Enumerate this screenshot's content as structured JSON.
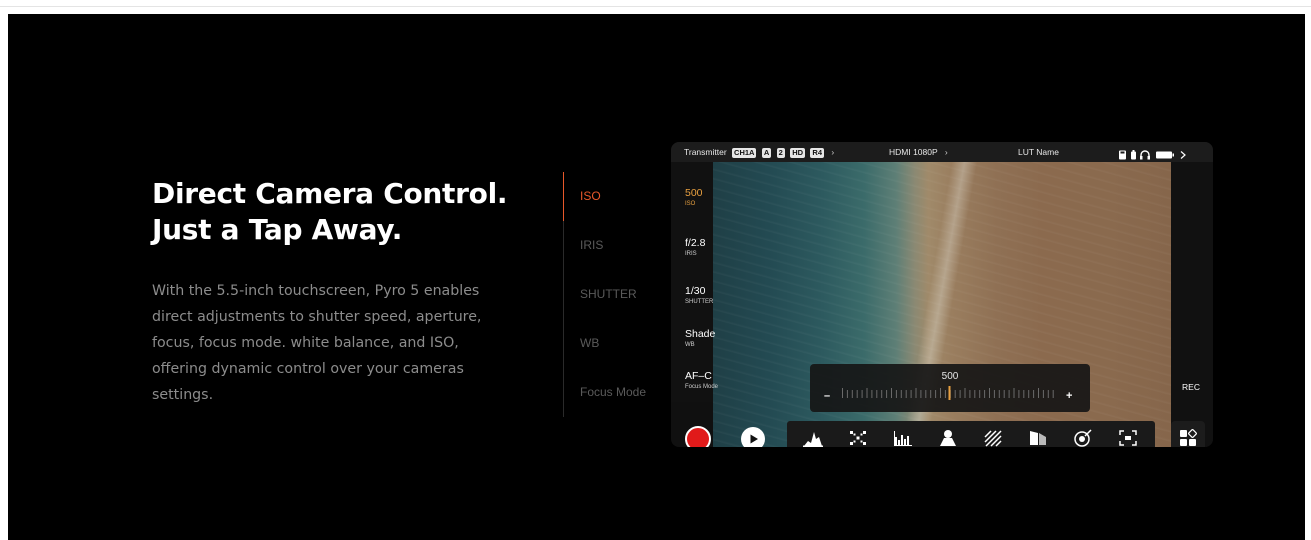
{
  "hero": {
    "title_line1": "Direct Camera Control.",
    "title_line2": "Just a Tap Away.",
    "description": "With the 5.5-inch touchscreen, Pyro 5 enables direct adjustments to shutter speed, aperture, focus, focus mode. white balance, and ISO, offering dynamic control over your cameras settings."
  },
  "tabs": [
    {
      "label": "ISO",
      "active": true
    },
    {
      "label": "IRIS",
      "active": false
    },
    {
      "label": "SHUTTER",
      "active": false
    },
    {
      "label": "WB",
      "active": false
    },
    {
      "label": "Focus Mode",
      "active": false
    }
  ],
  "device": {
    "status": {
      "transmitter_label": "Transmitter",
      "chips": [
        "CH1A",
        "A",
        "2",
        "HD",
        "R4"
      ],
      "hdmi": "HDMI 1080P",
      "lut": "LUT Name"
    },
    "params": [
      {
        "value": "500",
        "label": "ISO"
      },
      {
        "value": "f/2.8",
        "label": "IRIS"
      },
      {
        "value": "1/30",
        "label": "SHUTTER"
      },
      {
        "value": "Shade",
        "label": "WB"
      },
      {
        "value": "AF–C",
        "label": "Focus Mode"
      }
    ],
    "slider": {
      "value": "500",
      "minus": "–",
      "plus": "+"
    },
    "rec_label": "REC",
    "tool_icons": [
      "histogram-icon",
      "focus-peaking-icon",
      "waveform-icon",
      "false-color-icon",
      "zebra-icon",
      "vectorscope-icon",
      "anamorphic-icon",
      "zoom-icon"
    ],
    "colors": {
      "accent": "#e8582a",
      "rec": "#e11a1a",
      "param_active": "#e8a040"
    }
  }
}
